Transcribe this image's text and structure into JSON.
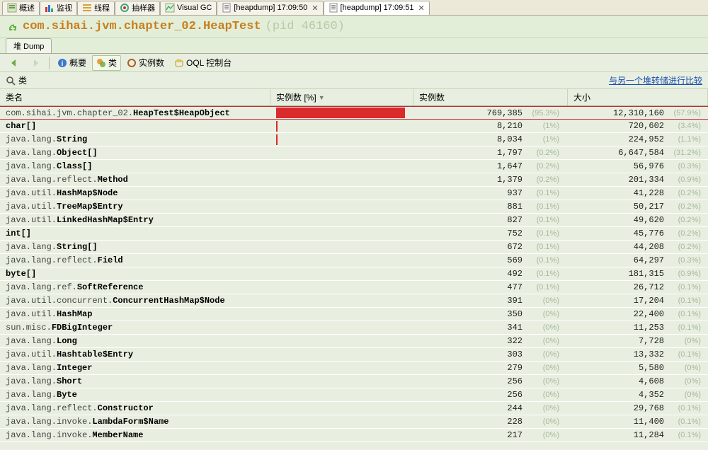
{
  "tabs": [
    {
      "label": "概述",
      "icon": "overview"
    },
    {
      "label": "监视",
      "icon": "monitor"
    },
    {
      "label": "线程",
      "icon": "threads"
    },
    {
      "label": "抽样器",
      "icon": "sampler"
    },
    {
      "label": "Visual GC",
      "icon": "visualgc"
    },
    {
      "label": "[heapdump] 17:09:50",
      "icon": "heapdump",
      "closable": true
    },
    {
      "label": "[heapdump] 17:09:51",
      "icon": "heapdump",
      "closable": true,
      "active": true
    }
  ],
  "title": {
    "main": "com.sihai.jvm.chapter_02.HeapTest",
    "pid": "(pid 46160)"
  },
  "subtab": "堆 Dump",
  "toolbar": {
    "back": "◄",
    "fwd": "►",
    "overview": "概要",
    "classes": "类",
    "instances": "实例数",
    "oql": "OQL 控制台"
  },
  "filter": {
    "label": "类",
    "compare_link": "与另一个堆转储进行比较"
  },
  "columns": {
    "name": "类名",
    "bar": "实例数  [%]",
    "inst": "实例数",
    "size": "大小"
  },
  "rows": [
    {
      "pkg": "com.sihai.jvm.chapter_02.",
      "cls": "HeapTest$HeapObject",
      "barPct": 95,
      "inst": "769,385",
      "instPct": "(95.3%)",
      "size": "12,310,160",
      "sizePct": "(57.9%)",
      "hl": true
    },
    {
      "pkg": "",
      "cls": "char[]",
      "barPct": 1,
      "inst": "8,210",
      "instPct": "(1%)",
      "size": "720,602",
      "sizePct": "(3.4%)"
    },
    {
      "pkg": "java.lang.",
      "cls": "String",
      "barPct": 1,
      "inst": "8,034",
      "instPct": "(1%)",
      "size": "224,952",
      "sizePct": "(1.1%)"
    },
    {
      "pkg": "java.lang.",
      "cls": "Object[]",
      "inst": "1,797",
      "instPct": "(0.2%)",
      "size": "6,647,584",
      "sizePct": "(31.2%)"
    },
    {
      "pkg": "java.lang.",
      "cls": "Class[]",
      "inst": "1,647",
      "instPct": "(0.2%)",
      "size": "56,976",
      "sizePct": "(0.3%)"
    },
    {
      "pkg": "java.lang.reflect.",
      "cls": "Method",
      "inst": "1,379",
      "instPct": "(0.2%)",
      "size": "201,334",
      "sizePct": "(0.9%)"
    },
    {
      "pkg": "java.util.",
      "cls": "HashMap$Node",
      "inst": "937",
      "instPct": "(0.1%)",
      "size": "41,228",
      "sizePct": "(0.2%)"
    },
    {
      "pkg": "java.util.",
      "cls": "TreeMap$Entry",
      "inst": "881",
      "instPct": "(0.1%)",
      "size": "50,217",
      "sizePct": "(0.2%)"
    },
    {
      "pkg": "java.util.",
      "cls": "LinkedHashMap$Entry",
      "inst": "827",
      "instPct": "(0.1%)",
      "size": "49,620",
      "sizePct": "(0.2%)"
    },
    {
      "pkg": "",
      "cls": "int[]",
      "inst": "752",
      "instPct": "(0.1%)",
      "size": "45,776",
      "sizePct": "(0.2%)"
    },
    {
      "pkg": "java.lang.",
      "cls": "String[]",
      "inst": "672",
      "instPct": "(0.1%)",
      "size": "44,208",
      "sizePct": "(0.2%)"
    },
    {
      "pkg": "java.lang.reflect.",
      "cls": "Field",
      "inst": "569",
      "instPct": "(0.1%)",
      "size": "64,297",
      "sizePct": "(0.3%)"
    },
    {
      "pkg": "",
      "cls": "byte[]",
      "inst": "492",
      "instPct": "(0.1%)",
      "size": "181,315",
      "sizePct": "(0.9%)"
    },
    {
      "pkg": "java.lang.ref.",
      "cls": "SoftReference",
      "inst": "477",
      "instPct": "(0.1%)",
      "size": "26,712",
      "sizePct": "(0.1%)"
    },
    {
      "pkg": "java.util.concurrent.",
      "cls": "ConcurrentHashMap$Node",
      "inst": "391",
      "instPct": "(0%)",
      "size": "17,204",
      "sizePct": "(0.1%)"
    },
    {
      "pkg": "java.util.",
      "cls": "HashMap",
      "inst": "350",
      "instPct": "(0%)",
      "size": "22,400",
      "sizePct": "(0.1%)"
    },
    {
      "pkg": "sun.misc.",
      "cls": "FDBigInteger",
      "inst": "341",
      "instPct": "(0%)",
      "size": "11,253",
      "sizePct": "(0.1%)"
    },
    {
      "pkg": "java.lang.",
      "cls": "Long",
      "inst": "322",
      "instPct": "(0%)",
      "size": "7,728",
      "sizePct": "(0%)"
    },
    {
      "pkg": "java.util.",
      "cls": "Hashtable$Entry",
      "inst": "303",
      "instPct": "(0%)",
      "size": "13,332",
      "sizePct": "(0.1%)"
    },
    {
      "pkg": "java.lang.",
      "cls": "Integer",
      "inst": "279",
      "instPct": "(0%)",
      "size": "5,580",
      "sizePct": "(0%)"
    },
    {
      "pkg": "java.lang.",
      "cls": "Short",
      "inst": "256",
      "instPct": "(0%)",
      "size": "4,608",
      "sizePct": "(0%)"
    },
    {
      "pkg": "java.lang.",
      "cls": "Byte",
      "inst": "256",
      "instPct": "(0%)",
      "size": "4,352",
      "sizePct": "(0%)"
    },
    {
      "pkg": "java.lang.reflect.",
      "cls": "Constructor",
      "inst": "244",
      "instPct": "(0%)",
      "size": "29,768",
      "sizePct": "(0.1%)"
    },
    {
      "pkg": "java.lang.invoke.",
      "cls": "LambdaForm$Name",
      "inst": "228",
      "instPct": "(0%)",
      "size": "11,400",
      "sizePct": "(0.1%)"
    },
    {
      "pkg": "java.lang.invoke.",
      "cls": "MemberName",
      "inst": "217",
      "instPct": "(0%)",
      "size": "11,284",
      "sizePct": "(0.1%)"
    }
  ]
}
